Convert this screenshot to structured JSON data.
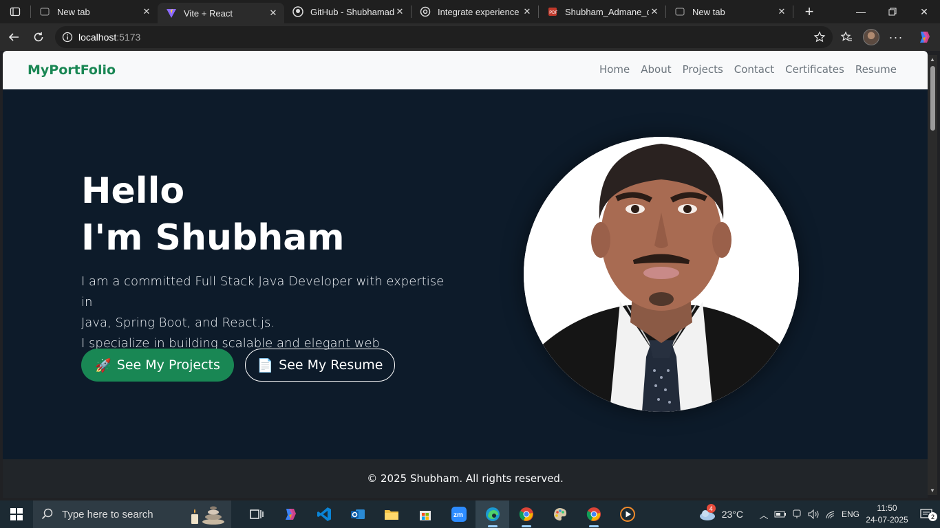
{
  "browser": {
    "tabs": [
      {
        "title": "New tab",
        "icon": "newtab-icon",
        "active": false
      },
      {
        "title": "Vite + React",
        "icon": "vite-icon",
        "active": true
      },
      {
        "title": "GitHub - Shubhamadm",
        "icon": "github-icon",
        "active": false
      },
      {
        "title": "Integrate experience se",
        "icon": "openai-icon",
        "active": false
      },
      {
        "title": "Shubham_Admane_cv.p",
        "icon": "pdf-icon",
        "active": false
      },
      {
        "title": "New tab",
        "icon": "newtab-icon",
        "active": false
      }
    ],
    "address": {
      "host": "localhost",
      "port": ":5173"
    }
  },
  "page": {
    "brand": "MyPortFolio",
    "nav": [
      "Home",
      "About",
      "Projects",
      "Contact",
      "Certificates",
      "Resume"
    ],
    "hero": {
      "line1": "Hello",
      "line2": "I'm Shubham",
      "desc1": "I am a committed Full Stack Java Developer with expertise in",
      "desc2": "Java, Spring Boot, and React.js.",
      "desc3": "I specialize in building scalable and elegant web applications.",
      "btn_projects": "See My Projects",
      "btn_projects_emoji": "🚀",
      "btn_resume": "See My Resume",
      "btn_resume_emoji": "📄"
    },
    "footer": "© 2025 Shubham. All rights reserved.",
    "colors": {
      "hero_bg": "#0d1b2a",
      "accent": "#198754",
      "brand": "#1a8754",
      "footer_bg": "#212529"
    }
  },
  "taskbar": {
    "search_placeholder": "Type here to search",
    "weather_temp": "23°C",
    "weather_badge": "4",
    "language": "ENG",
    "time": "11:50",
    "date": "24-07-2025",
    "notification_count": "2"
  }
}
